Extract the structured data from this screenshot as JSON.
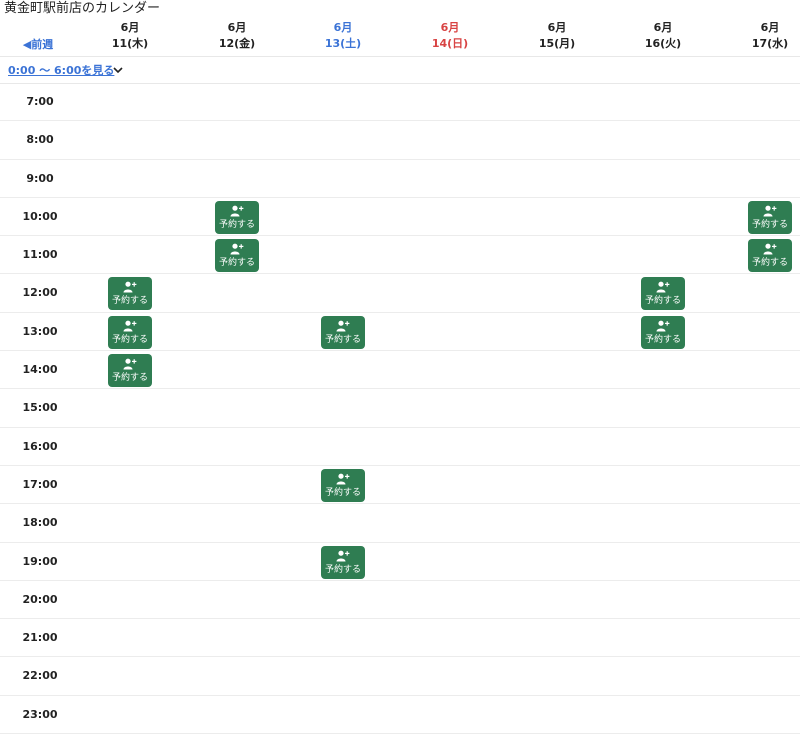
{
  "page": {
    "title": "黄金町駅前店のカレンダー"
  },
  "nav": {
    "prev_week": "◀前週",
    "show_early": "0:00 〜 6:00を見る"
  },
  "days": [
    {
      "month": "6月",
      "date": "11(木)",
      "kind": "weekday"
    },
    {
      "month": "6月",
      "date": "12(金)",
      "kind": "weekday"
    },
    {
      "month": "6月",
      "date": "13(土)",
      "kind": "sat"
    },
    {
      "month": "6月",
      "date": "14(日)",
      "kind": "sun"
    },
    {
      "month": "6月",
      "date": "15(月)",
      "kind": "weekday"
    },
    {
      "month": "6月",
      "date": "16(火)",
      "kind": "weekday"
    },
    {
      "month": "6月",
      "date": "17(水)",
      "kind": "weekday"
    }
  ],
  "hours": [
    "7:00",
    "8:00",
    "9:00",
    "10:00",
    "11:00",
    "12:00",
    "13:00",
    "14:00",
    "15:00",
    "16:00",
    "17:00",
    "18:00",
    "19:00",
    "20:00",
    "21:00",
    "22:00",
    "23:00"
  ],
  "book_label": "予約する",
  "icons": {
    "book": "user-plus-icon",
    "expand": "chevron-down-icon"
  },
  "colors": {
    "accent": "#3b73d6",
    "sunday": "#d84343",
    "button": "#2f7d52"
  },
  "slots": [
    {
      "day": 1,
      "hour": "10:00"
    },
    {
      "day": 6,
      "hour": "10:00"
    },
    {
      "day": 1,
      "hour": "11:00"
    },
    {
      "day": 6,
      "hour": "11:00"
    },
    {
      "day": 0,
      "hour": "12:00"
    },
    {
      "day": 5,
      "hour": "12:00"
    },
    {
      "day": 0,
      "hour": "13:00"
    },
    {
      "day": 2,
      "hour": "13:00"
    },
    {
      "day": 5,
      "hour": "13:00"
    },
    {
      "day": 0,
      "hour": "14:00"
    },
    {
      "day": 2,
      "hour": "17:00"
    },
    {
      "day": 2,
      "hour": "19:00"
    }
  ]
}
